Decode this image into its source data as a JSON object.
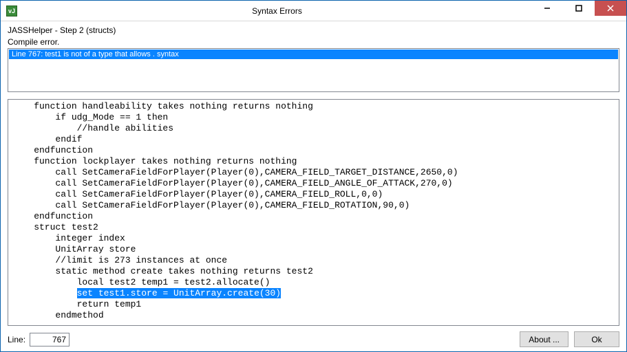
{
  "window": {
    "title": "Syntax Errors",
    "icon_text": "vJ"
  },
  "header": {
    "subtitle": "JASSHelper - Step 2 (structs)",
    "compile_label": "Compile error."
  },
  "errors": [
    {
      "text": "Line 767: test1 is not of a type that allows . syntax"
    }
  ],
  "code": {
    "lines": [
      "    function handleability takes nothing returns nothing",
      "        if udg_Mode == 1 then",
      "            //handle abilities",
      "        endif",
      "    endfunction",
      "",
      "    function lockplayer takes nothing returns nothing",
      "        call SetCameraFieldForPlayer(Player(0),CAMERA_FIELD_TARGET_DISTANCE,2650,0)",
      "        call SetCameraFieldForPlayer(Player(0),CAMERA_FIELD_ANGLE_OF_ATTACK,270,0)",
      "        call SetCameraFieldForPlayer(Player(0),CAMERA_FIELD_ROLL,0,0)",
      "        call SetCameraFieldForPlayer(Player(0),CAMERA_FIELD_ROTATION,90,0)",
      "    endfunction",
      "    struct test2",
      "        integer index",
      "        UnitArray store",
      "        //limit is 273 instances at once",
      "        static method create takes nothing returns test2",
      "            local test2 temp1 = test2.allocate()",
      "            set test1.store = UnitArray.create(30)",
      "            return temp1",
      "        endmethod"
    ],
    "highlight_index": 18,
    "highlight_prefix": "            ",
    "highlight_text": "set test1.store = UnitArray.create(30)"
  },
  "footer": {
    "line_label": "Line:",
    "line_value": "767",
    "about_label": "About ...",
    "ok_label": "Ok"
  }
}
